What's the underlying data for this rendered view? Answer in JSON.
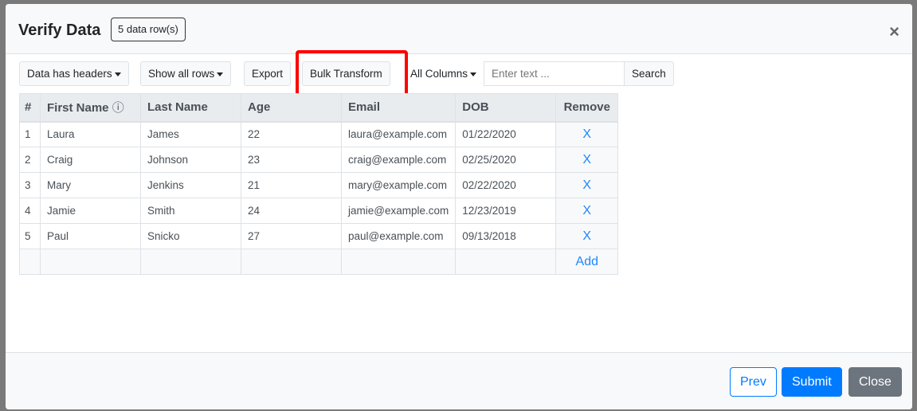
{
  "header": {
    "title": "Verify Data",
    "badge": "5 data row(s)",
    "close": "×"
  },
  "toolbar": {
    "headers": "Data has headers",
    "rows": "Show all rows",
    "export": "Export",
    "bulk": "Bulk Transform",
    "columns": "All Columns",
    "search_placeholder": "Enter text ...",
    "search": "Search"
  },
  "table": {
    "headers": [
      "#",
      "First Name",
      "Last Name",
      "Age",
      "Email",
      "DOB",
      "Remove"
    ],
    "info_icon": "ⓘ",
    "rows": [
      [
        "1",
        "Laura",
        "James",
        "22",
        "laura@example.com",
        "01/22/2020"
      ],
      [
        "2",
        "Craig",
        "Johnson",
        "23",
        "craig@example.com",
        "02/25/2020"
      ],
      [
        "3",
        "Mary",
        "Jenkins",
        "21",
        "mary@example.com",
        "02/22/2020"
      ],
      [
        "4",
        "Jamie",
        "Smith",
        "24",
        "jamie@example.com",
        "12/23/2019"
      ],
      [
        "5",
        "Paul",
        "Snicko",
        "27",
        "paul@example.com",
        "09/13/2018"
      ]
    ],
    "remove": "X",
    "add": "Add"
  },
  "footer": {
    "prev": "Prev",
    "submit": "Submit",
    "close": "Close"
  },
  "colors": {
    "accent": "#007bff",
    "highlight": "#ff0000",
    "secondary": "#6c757d"
  }
}
